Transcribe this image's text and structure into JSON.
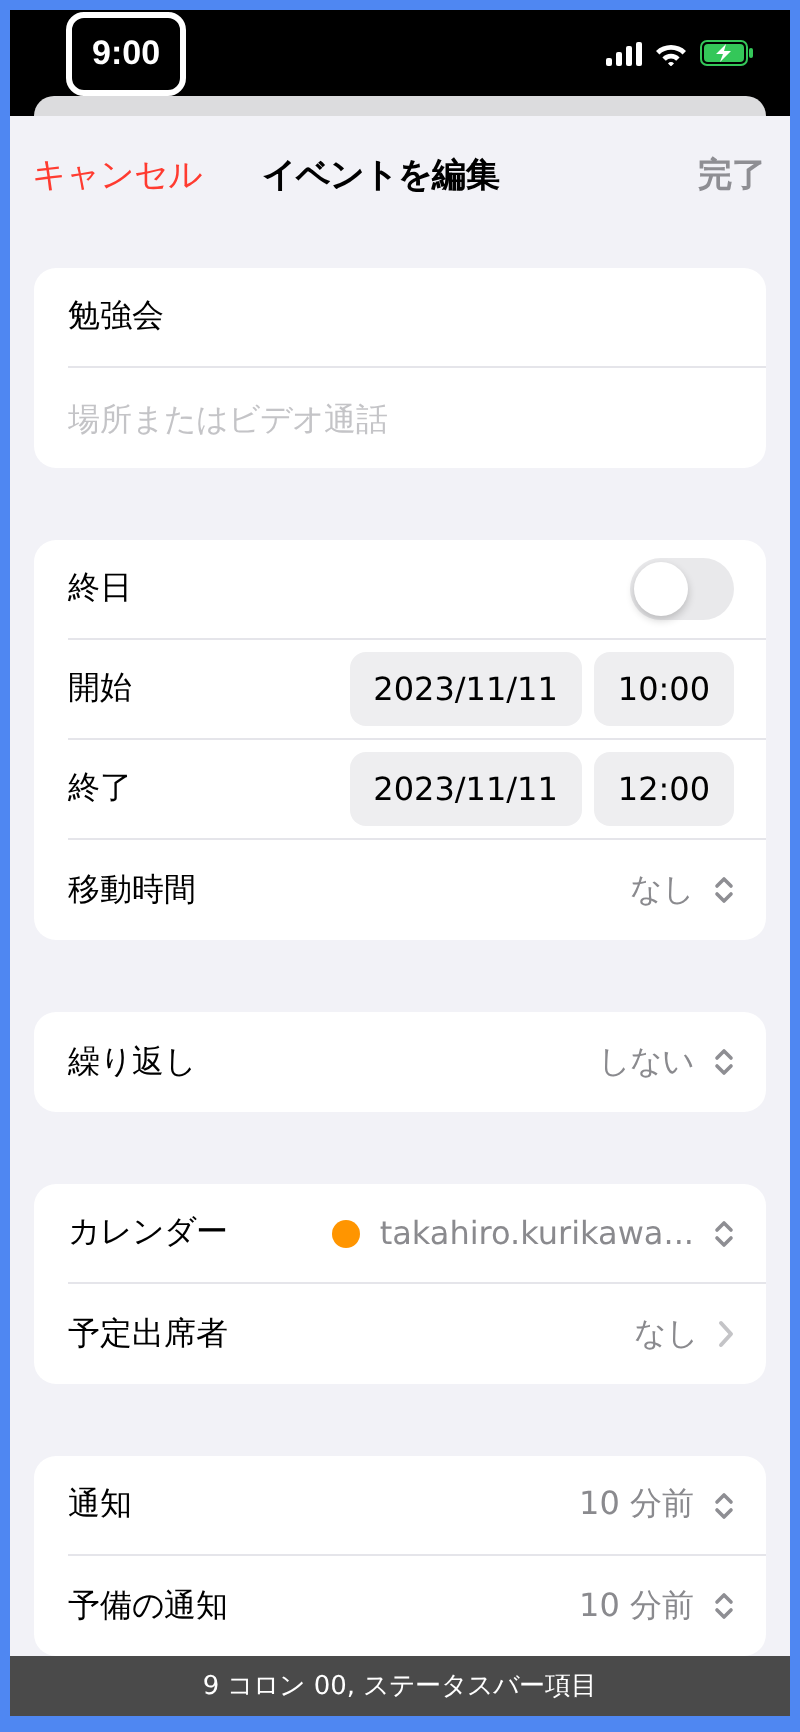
{
  "status_bar": {
    "time": "9:00",
    "time_focused": true
  },
  "header": {
    "cancel": "キャンセル",
    "title": "イベントを編集",
    "done": "完了",
    "done_disabled": true
  },
  "sections": [
    {
      "rows": [
        {
          "kind": "field",
          "value": "勉強会"
        },
        {
          "kind": "field",
          "placeholder": "場所またはビデオ通話"
        }
      ]
    },
    {
      "rows": [
        {
          "kind": "toggle",
          "label": "終日",
          "on": false
        },
        {
          "kind": "datetime",
          "label": "開始",
          "date": "2023/11/11",
          "time": "10:00"
        },
        {
          "kind": "datetime",
          "label": "終了",
          "date": "2023/11/11",
          "time": "12:00"
        },
        {
          "kind": "select",
          "label": "移動時間",
          "value": "なし"
        }
      ]
    },
    {
      "rows": [
        {
          "kind": "select",
          "label": "繰り返し",
          "value": "しない"
        }
      ]
    },
    {
      "rows": [
        {
          "kind": "select",
          "label": "カレンダー",
          "value": "takahiro.kurikawa...",
          "color": "#ff9500"
        },
        {
          "kind": "link",
          "label": "予定出席者",
          "value": "なし"
        }
      ]
    },
    {
      "rows": [
        {
          "kind": "select",
          "label": "通知",
          "value": "10 分前"
        },
        {
          "kind": "select",
          "label": "予備の通知",
          "value": "10 分前"
        }
      ]
    }
  ],
  "caption": "9 コロン 00, ステータスバー項目"
}
